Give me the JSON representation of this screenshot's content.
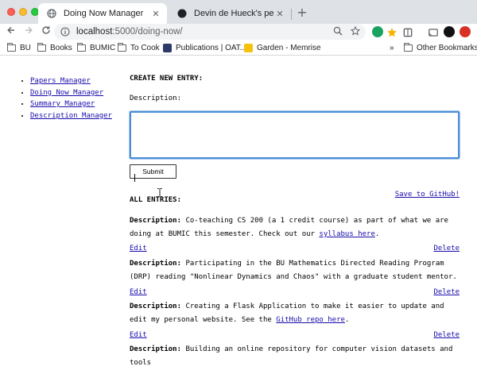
{
  "browser": {
    "tabs": [
      {
        "title": "Doing Now Manager",
        "active": true
      },
      {
        "title": "Devin de Hueck's personal site",
        "active": false
      }
    ],
    "new_tab_symbol": "+",
    "url_host": "localhost",
    "url_path": ":5000/doing-now/",
    "bookmarks": [
      {
        "label": "BU",
        "icon": "folder-icon"
      },
      {
        "label": "Books",
        "icon": "folder-icon"
      },
      {
        "label": "BUMIC",
        "icon": "folder-icon"
      },
      {
        "label": "To Cook",
        "icon": "folder-icon"
      },
      {
        "label": "Publications | OAT...",
        "icon": "site-favicon"
      },
      {
        "label": "Garden - Memrise",
        "icon": "memrise-favicon"
      }
    ],
    "bookmarks_overflow": "»",
    "other_bookmarks": "Other Bookmarks",
    "colors": {
      "tabstrip": "#dee1e6",
      "omnibox": "#f1f3f4",
      "focus": "#4a8fd6",
      "link": "#1a0dab"
    }
  },
  "sidebar": {
    "items": [
      {
        "label": "Papers Manager"
      },
      {
        "label": "Doing Now Manager"
      },
      {
        "label": "Summary Manager"
      },
      {
        "label": "Description Manager"
      }
    ]
  },
  "form": {
    "heading": "CREATE NEW ENTRY:",
    "description_label": "Description:",
    "textarea_value": "",
    "submit_label": "Submit"
  },
  "entries_section": {
    "heading": "ALL ENTRIES:",
    "save_link": "Save to GitHub!",
    "edit_label": "Edit",
    "delete_label": "Delete",
    "entries": [
      {
        "label": "Description:",
        "text_before": " Co-teaching CS 200 (a 1 credit course) as part of what we are doing at BUMIC this semester. Check out our ",
        "link": "syllabus here",
        "text_after": "."
      },
      {
        "label": "Description:",
        "text_before": " Participating in the BU Mathematics Directed Reading Program (DRP) reading \"Nonlinear Dynamics and Chaos\" with a graduate student mentor.",
        "link": "",
        "text_after": ""
      },
      {
        "label": "Description:",
        "text_before": " Creating a Flask Application to make it easier to update and edit my personal website. See the ",
        "link": "GitHub repo here",
        "text_after": "."
      },
      {
        "label": "Description:",
        "text_before": " Building an online repository for computer vision datasets and tools",
        "link": "",
        "text_after": ""
      }
    ]
  }
}
